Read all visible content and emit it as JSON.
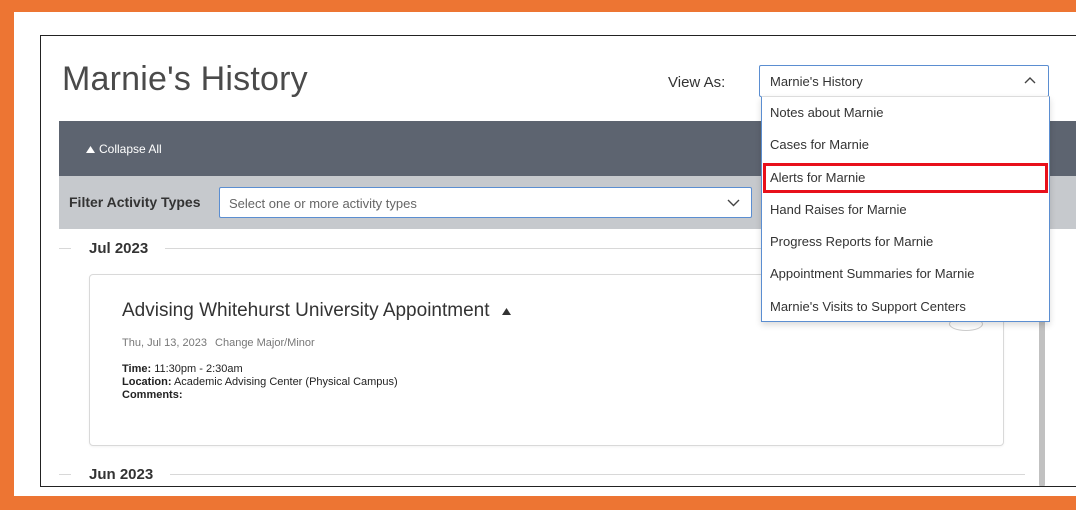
{
  "page": {
    "title": "Marnie's History",
    "view_as_label": "View As:",
    "view_as_selected": "Marnie's History",
    "view_as_options": [
      "Notes about Marnie",
      "Cases for Marnie",
      "Alerts for Marnie",
      "Hand Raises for Marnie",
      "Progress Reports for Marnie",
      "Appointment Summaries for Marnie",
      "Marnie's Visits to Support Centers"
    ],
    "highlighted_option_index": 2
  },
  "toolbar": {
    "collapse_all_label": "Collapse All"
  },
  "filter": {
    "label": "Filter Activity Types",
    "placeholder": "Select one or more activity types"
  },
  "timeline": {
    "months": [
      "Jul 2023",
      "Jun 2023"
    ],
    "card": {
      "title": "Advising Whitehurst University Appointment",
      "date": "Thu, Jul 13, 2023",
      "reason": "Change Major/Minor",
      "time_label": "Time:",
      "time_value": "11:30pm - 2:30am",
      "location_label": "Location:",
      "location_value": "Academic Advising Center (Physical Campus)",
      "comments_label": "Comments:",
      "comments_value": ""
    }
  },
  "colors": {
    "frame": "#ed7533",
    "toolbar": "#5d6470",
    "filter_bar": "#c6c9cd",
    "select_border": "#5b8ed1",
    "highlight": "#e8101b"
  },
  "icons": {
    "view_as_chevron": "chevron-up-icon",
    "collapse": "triangle-up-icon",
    "filter_chevron": "chevron-down-icon",
    "card_toggle": "triangle-up-icon"
  }
}
